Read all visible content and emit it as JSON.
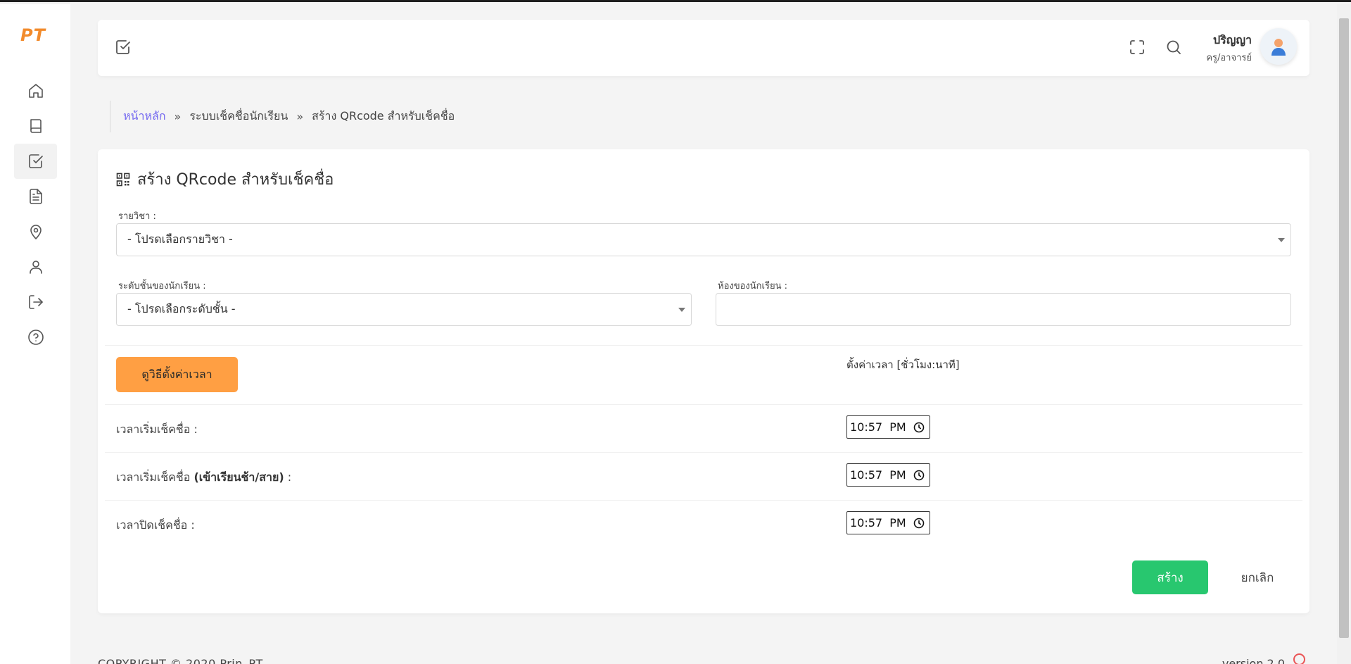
{
  "logo": "PT",
  "sidebar": {
    "items": [
      {
        "icon": "home-icon",
        "active": false
      },
      {
        "icon": "book-icon",
        "active": false
      },
      {
        "icon": "check-square-icon",
        "active": true
      },
      {
        "icon": "file-text-icon",
        "active": false
      },
      {
        "icon": "map-pin-icon",
        "active": false
      },
      {
        "icon": "user-icon",
        "active": false
      },
      {
        "icon": "log-out-icon",
        "active": false
      },
      {
        "icon": "help-circle-icon",
        "active": false
      }
    ]
  },
  "header": {
    "user_name": "ปริญญา",
    "user_role": "ครู/อาจารย์"
  },
  "breadcrumb": {
    "home": "หน้าหลัก",
    "level1": "ระบบเช็คชื่อนักเรียน",
    "current": "สร้าง QRcode สำหรับเช็คชื่อ",
    "separator": "»"
  },
  "form": {
    "title": "สร้าง QRcode สำหรับเช็คชื่อ",
    "subject_label": "รายวิชา :",
    "subject_value": "- โปรดเลือกรายวิชา -",
    "level_label": "ระดับชั้นของนักเรียน :",
    "level_value": "- โปรดเลือกระดับชั้น -",
    "room_label": "ห้องของนักเรียน :",
    "room_value": "",
    "howto_button": "ดูวิธีตั้งค่าเวลา",
    "time_header": "ตั้งค่าเวลา [ชั่วโมง:นาที]",
    "rows": [
      {
        "label": "เวลาเริ่มเช็คชื่อ :",
        "label_bold": "",
        "label_suffix": "",
        "time": "10:57  PM"
      },
      {
        "label": "เวลาเริ่มเช็คชื่อ ",
        "label_bold": "(เข้าเรียนช้า/สาย)",
        "label_suffix": " :",
        "time": "10:57  PM"
      },
      {
        "label": "เวลาปิดเช็คชื่อ :",
        "label_bold": "",
        "label_suffix": "",
        "time": "10:57  PM"
      }
    ],
    "create_button": "สร้าง",
    "cancel_button": "ยกเลิก"
  },
  "footer": {
    "copyright": "COPYRIGHT © 2020 Prin_PT",
    "version": "version 2.0"
  },
  "colors": {
    "accent": "#7367f0",
    "logo": "#f28b2c",
    "orange_button": "#ff9f43",
    "green_button": "#28c76f"
  }
}
